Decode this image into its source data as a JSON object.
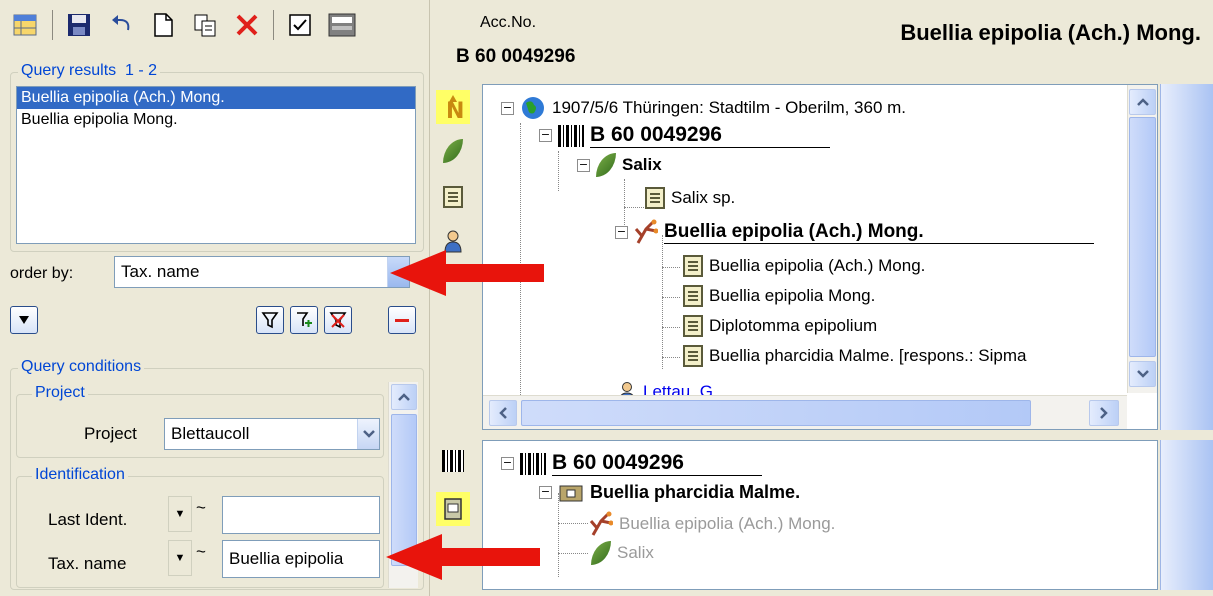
{
  "toolbar": {
    "icons": [
      "grid-icon",
      "save-icon",
      "undo-icon",
      "new-icon",
      "copy-icon",
      "delete-icon",
      "check-icon",
      "print-icon"
    ]
  },
  "query_results": {
    "label": "Query results",
    "range": "1 - 2",
    "items": [
      "Buellia epipolia (Ach.) Mong.",
      "Buellia epipolia Mong."
    ]
  },
  "order_by": {
    "label": "order by:",
    "value": "Tax. name"
  },
  "query_conditions": {
    "label": "Query conditions",
    "project_group": "Project",
    "project_label": "Project",
    "project_value": "Blettaucoll",
    "identification_group": "Identification",
    "last_ident_label": "Last Ident.",
    "last_ident_value": "",
    "tax_name_label": "Tax. name",
    "tax_name_value": "Buellia epipolia",
    "tilde": "~"
  },
  "header": {
    "acc_label": "Acc.No.",
    "acc_value": "B 60 0049296",
    "title": "Buellia epipolia (Ach.) Mong."
  },
  "top_tree": {
    "event": "1907/5/6 Thüringen: Stadtilm - Oberilm, 360 m.",
    "specimen": "B 60 0049296",
    "plant": "Salix",
    "plant_ident": "Salix sp.",
    "lichen": "Buellia epipolia (Ach.) Mong.",
    "idents": [
      "Buellia epipolia (Ach.) Mong.",
      "Buellia epipolia Mong.",
      "Diplotomma epipolium",
      "Buellia pharcidia Malme.   [respons.: Sipma"
    ],
    "collector": "Lettau, G."
  },
  "bottom_tree": {
    "specimen": "B 60 0049296",
    "part": "Buellia pharcidia Malme.",
    "child1": "Buellia epipolia (Ach.) Mong.",
    "child2": "Salix"
  },
  "colors": {
    "accent": "#316ac5",
    "arrow": "#e8140c",
    "highlight": "#ffff66"
  }
}
